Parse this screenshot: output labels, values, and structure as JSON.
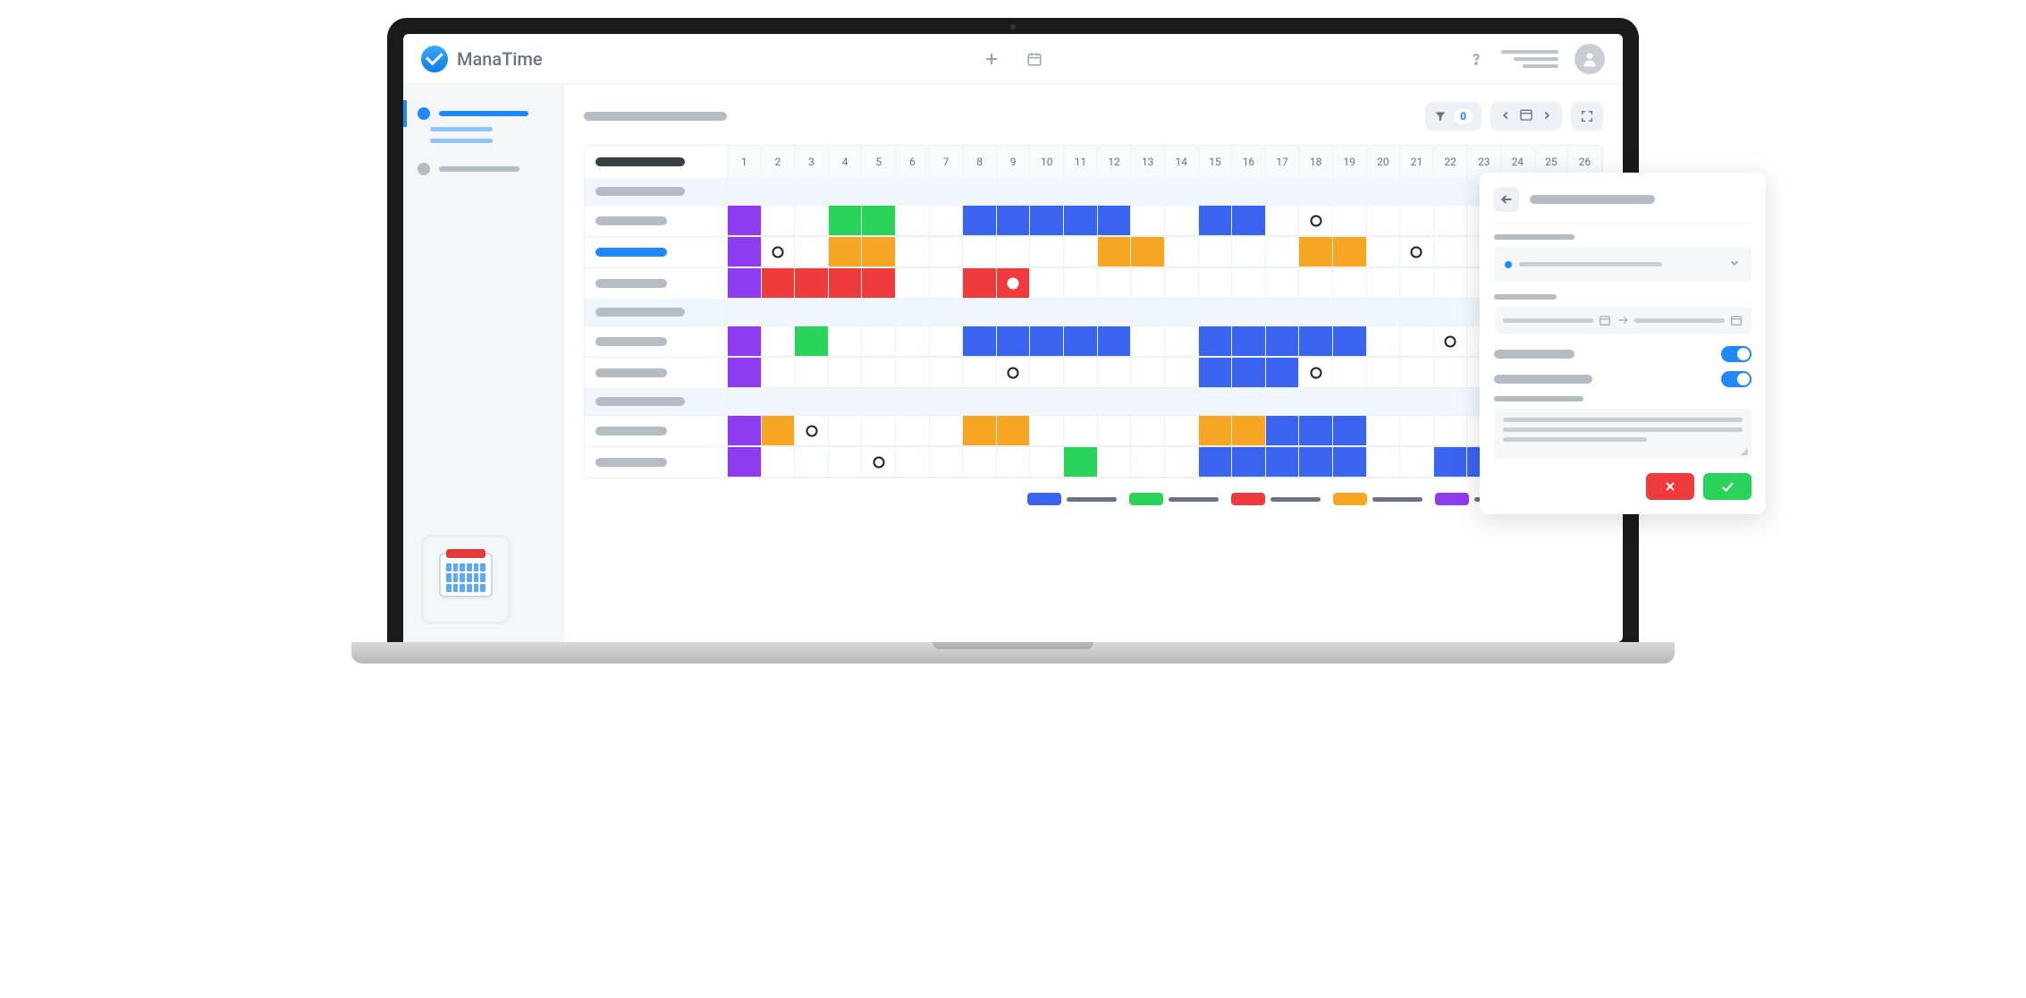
{
  "app": {
    "name": "ManaTime"
  },
  "toolbar": {
    "filter_count": "0"
  },
  "calendar": {
    "days": [
      "1",
      "2",
      "3",
      "4",
      "5",
      "6",
      "7",
      "8",
      "9",
      "10",
      "11",
      "12",
      "13",
      "14",
      "15",
      "16",
      "17",
      "18",
      "19",
      "20",
      "21",
      "22",
      "23",
      "24",
      "25",
      "26"
    ],
    "groups": [
      {
        "rows": [
          {
            "cells": {
              "1": "purple",
              "4": "green",
              "5": "green",
              "8": "blue",
              "9": "blue",
              "10": "blue",
              "11": "blue",
              "12": "blue",
              "15": "blue",
              "16": "blue",
              "18": "marker"
            }
          },
          {
            "selected": true,
            "cells": {
              "1": "purple",
              "2": "marker",
              "4": "orange",
              "5": "orange",
              "12": "orange",
              "13": "orange",
              "18": "orange",
              "19": "orange",
              "21": "marker",
              "26": "green"
            }
          },
          {
            "cells": {
              "1": "purple",
              "2": "red",
              "3": "red",
              "4": "red",
              "5": "red",
              "8": "red",
              "9": "red-marker",
              "26": "red"
            }
          }
        ]
      },
      {
        "rows": [
          {
            "cells": {
              "1": "purple",
              "3": "green",
              "8": "blue",
              "9": "blue",
              "10": "blue",
              "11": "blue",
              "12": "blue",
              "15": "blue",
              "16": "blue",
              "17": "blue",
              "18": "blue",
              "19": "blue",
              "22": "marker",
              "24": "green",
              "25": "green"
            }
          },
          {
            "cells": {
              "1": "purple",
              "9": "marker",
              "15": "blue",
              "16": "blue",
              "17": "blue",
              "18": "marker",
              "25": "red",
              "26": "red"
            }
          }
        ]
      },
      {
        "rows": [
          {
            "cells": {
              "1": "purple",
              "2": "orange",
              "3": "marker",
              "8": "orange",
              "9": "orange",
              "15": "orange",
              "16": "orange",
              "17": "blue",
              "18": "blue",
              "19": "blue",
              "25": "orange"
            }
          },
          {
            "cells": {
              "1": "purple",
              "5": "marker",
              "11": "green",
              "15": "blue",
              "16": "blue",
              "17": "blue",
              "18": "blue",
              "19": "blue",
              "22": "blue",
              "23": "blue",
              "24": "blue",
              "25": "blue",
              "26": "blue"
            }
          }
        ]
      }
    ]
  },
  "legend": {
    "colors": [
      "#3a63f0",
      "#2ad45a",
      "#ef3b3b",
      "#f6a623",
      "#8f3cf0"
    ]
  },
  "panel": {
    "toggle1": true,
    "toggle2": true
  }
}
